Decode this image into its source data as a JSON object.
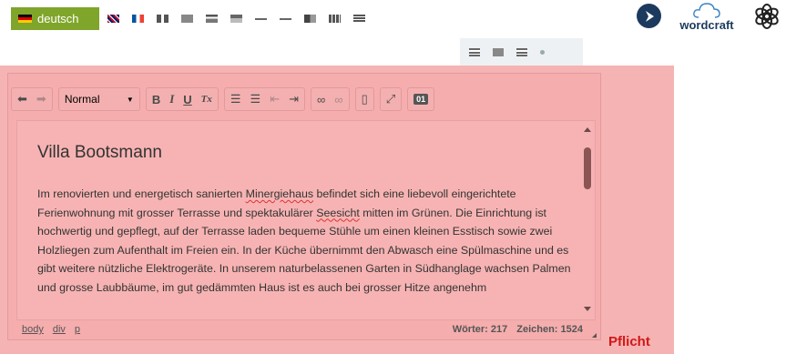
{
  "language_tabs": {
    "active": "deutsch",
    "flag_icons": [
      "english-flag-icon",
      "french-flag-icon",
      "lang-flag-icon",
      "lang-flag-icon",
      "lang-flag-icon",
      "lang-flag-icon",
      "lang-flag-icon",
      "lang-flag-icon",
      "lang-flag-icon",
      "lang-flag-icon",
      "lang-flag-icon"
    ],
    "second_row_icons": [
      "lang-flag-icon",
      "lang-flag-icon",
      "lang-flag-icon",
      "lang-flag-icon"
    ]
  },
  "logos": {
    "wordcraft": "wordcraft"
  },
  "toolbar": {
    "format_select": "Normal",
    "bold": "B",
    "italic": "I",
    "underline": "U",
    "clear_format": "Tx",
    "source_label": "01"
  },
  "editor": {
    "title": "Villa Bootsmann",
    "body_parts": [
      "Im renovierten und energetisch sanierten ",
      "Minergiehaus",
      " befindet sich eine liebevoll eingerichtete Ferienwohnung mit grosser Terrasse und spektakulärer ",
      "Seesicht",
      " mitten im Grünen. Die Einrichtung ist hochwertig und gepflegt, auf der Terrasse laden bequeme Stühle um einen kleinen Esstisch sowie zwei Holzliegen zum Aufenthalt im Freien ein. In der Küche übernimmt den Abwasch eine Spülmaschine und es gibt weitere nützliche Elektrogeräte. In unserem naturbelassenen Garten in Südhanglage wachsen Palmen und grosse Laubbäume, im gut gedämmten Haus ist es auch bei grosser Hitze angenehm"
    ]
  },
  "statusbar": {
    "path": [
      "body",
      "div",
      "p"
    ],
    "words": "Wörter: 217",
    "chars": "Zeichen: 1524"
  },
  "required_label": "Pflicht",
  "colors": {
    "required_bg": "#f6b3b3",
    "active_tab": "#7fa52a",
    "required_text": "#d01818"
  }
}
